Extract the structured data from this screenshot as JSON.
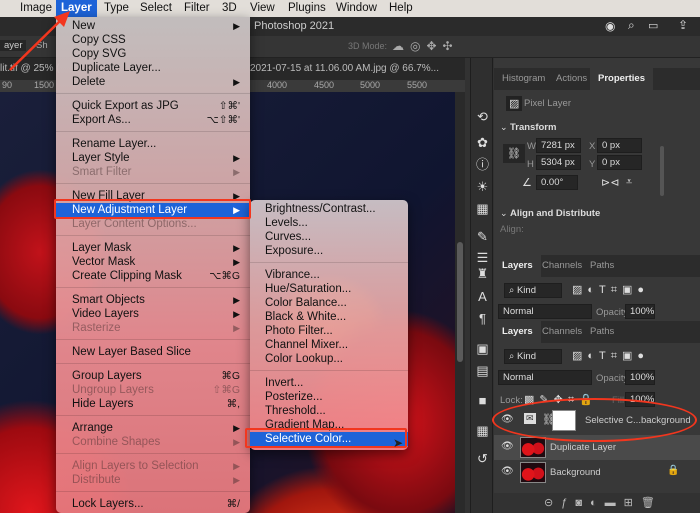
{
  "menubar": {
    "items": [
      "Image",
      "Layer",
      "Type",
      "Select",
      "Filter",
      "3D",
      "View",
      "Plugins",
      "Window",
      "Help"
    ],
    "active": "Layer"
  },
  "titlebar": {
    "title": "Photoshop 2021"
  },
  "optbar": {
    "layer_select": "ayer",
    "show_label": "Sh",
    "mode_label": "3D Mode:"
  },
  "tabs": [
    {
      "label": "lit.tif @ 25% ("
    },
    {
      "label": "2021-07-15 at 11.06.00 AM.jpg @ 66.7%..."
    }
  ],
  "ruler": {
    "ticks": [
      "90",
      "1500",
      "4000",
      "4500",
      "5000",
      "5500"
    ]
  },
  "layer_menu": [
    {
      "label": "New",
      "arrow": true
    },
    {
      "label": "Copy CSS"
    },
    {
      "label": "Copy SVG"
    },
    {
      "label": "Duplicate Layer..."
    },
    {
      "label": "Delete",
      "arrow": true
    },
    {
      "sep": true
    },
    {
      "label": "Quick Export as JPG",
      "shortcut": "⇧⌘'"
    },
    {
      "label": "Export As...",
      "shortcut": "⌥⇧⌘'"
    },
    {
      "sep": true
    },
    {
      "label": "Rename Layer..."
    },
    {
      "label": "Layer Style",
      "arrow": true
    },
    {
      "label": "Smart Filter",
      "arrow": true,
      "disabled": true
    },
    {
      "sep": true
    },
    {
      "label": "New Fill Layer",
      "arrow": true
    },
    {
      "label": "New Adjustment Layer",
      "arrow": true,
      "highlighted": true
    },
    {
      "label": "Layer Content Options...",
      "disabled": true
    },
    {
      "sep": true
    },
    {
      "label": "Layer Mask",
      "arrow": true
    },
    {
      "label": "Vector Mask",
      "arrow": true
    },
    {
      "label": "Create Clipping Mask",
      "shortcut": "⌥⌘G"
    },
    {
      "sep": true
    },
    {
      "label": "Smart Objects",
      "arrow": true
    },
    {
      "label": "Video Layers",
      "arrow": true
    },
    {
      "label": "Rasterize",
      "arrow": true,
      "disabled": true
    },
    {
      "sep": true
    },
    {
      "label": "New Layer Based Slice"
    },
    {
      "sep": true
    },
    {
      "label": "Group Layers",
      "shortcut": "⌘G"
    },
    {
      "label": "Ungroup Layers",
      "shortcut": "⇧⌘G",
      "disabled": true
    },
    {
      "label": "Hide Layers",
      "shortcut": "⌘,"
    },
    {
      "sep": true
    },
    {
      "label": "Arrange",
      "arrow": true
    },
    {
      "label": "Combine Shapes",
      "arrow": true,
      "disabled": true
    },
    {
      "sep": true
    },
    {
      "label": "Align Layers to Selection",
      "arrow": true,
      "disabled": true
    },
    {
      "label": "Distribute",
      "arrow": true,
      "disabled": true
    },
    {
      "sep": true
    },
    {
      "label": "Lock Layers...",
      "shortcut": "⌘/"
    }
  ],
  "adjustment_submenu": [
    {
      "label": "Brightness/Contrast..."
    },
    {
      "label": "Levels..."
    },
    {
      "label": "Curves..."
    },
    {
      "label": "Exposure..."
    },
    {
      "sep": true
    },
    {
      "label": "Vibrance..."
    },
    {
      "label": "Hue/Saturation..."
    },
    {
      "label": "Color Balance..."
    },
    {
      "label": "Black & White..."
    },
    {
      "label": "Photo Filter..."
    },
    {
      "label": "Channel Mixer..."
    },
    {
      "label": "Color Lookup..."
    },
    {
      "sep": true
    },
    {
      "label": "Invert..."
    },
    {
      "label": "Posterize..."
    },
    {
      "label": "Threshold..."
    },
    {
      "label": "Gradient Map..."
    },
    {
      "label": "Selective Color...",
      "highlighted": true
    }
  ],
  "properties": {
    "tabs": [
      "Histogram",
      "Actions",
      "Properties"
    ],
    "active_tab": "Properties",
    "kind": "Pixel Layer",
    "transform_title": "Transform",
    "w_label": "W",
    "w": "7281 px",
    "h_label": "H",
    "h": "5304 px",
    "x_label": "X",
    "x": "0 px",
    "y_label": "Y",
    "y": "0 px",
    "angle": "0.00°",
    "align_title": "Align and Distribute",
    "align_label": "Align:"
  },
  "layers_top": {
    "tabs": [
      "Layers",
      "Channels",
      "Paths"
    ],
    "kind": "Kind",
    "blend": "Normal",
    "opacity_label": "Opacity:",
    "opacity": "100%"
  },
  "layers": {
    "tabs": [
      "Layers",
      "Channels",
      "Paths"
    ],
    "kind": "Kind",
    "blend": "Normal",
    "opacity_label": "Opacity:",
    "opacity": "100%",
    "lock_label": "Lock:",
    "fill_label": "Fill:",
    "fill": "100%",
    "rows": [
      {
        "name": "Selective C...background",
        "type": "adjustment"
      },
      {
        "name": "Duplicate Layer",
        "type": "pixel",
        "selected": true
      },
      {
        "name": "Background",
        "type": "pixel",
        "locked": true
      }
    ]
  },
  "colors": {
    "highlight": "#1d63d8",
    "annotation": "#f2361e"
  }
}
